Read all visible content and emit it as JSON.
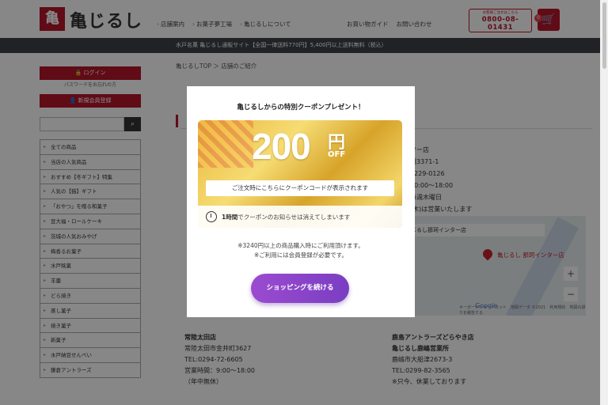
{
  "header": {
    "logo_mark": "亀",
    "logo_text": "亀じるし",
    "nav": [
      "店舗案内",
      "お菓子夢工場",
      "亀じるしについて"
    ],
    "nav2": [
      "お買い物ガイド",
      "お問い合わせ"
    ],
    "tel_small": "お客様ご注文はこちら",
    "tel_number": "0800-08-01431",
    "cart_count": "0"
  },
  "banner": {
    "text": "水戸名菓 亀じるし通販サイト【全国一律送料770円】5,400円以上送料無料（税込）"
  },
  "sidebar": {
    "login_label": "ログイン",
    "password_note": "パスワードをお忘れの方",
    "register_label": "新規会員登録",
    "search_placeholder": "",
    "categories": [
      "全ての商品",
      "当店の人気商品",
      "おすすめ【冬ギフト】特集",
      "人気の【猫】ギフト",
      "「おやつ」を贈る和菓子",
      "豆大福・ロールケーキ",
      "茨城の人気おみやげ",
      "梅香るお菓子",
      "水戸銘菓",
      "羊羹",
      "どら焼き",
      "蒸し菓子",
      "焼き菓子",
      "新菓子",
      "水戸納豆せんべい",
      "鎌倉アントラーズ"
    ]
  },
  "main": {
    "breadcrumb": "亀じるしTOP ＞ 店舗のご紹介",
    "store_right": [
      "ンター店",
      "飯田3371-1",
      "29-229-0126",
      "：10:00～18:00",
      "：毎週木曜日",
      "日(木)は営業いたします"
    ],
    "map": {
      "label": "亀じるし那珂インター店",
      "pin_name": "亀じるし 那珂インター店",
      "google": "Google",
      "footer": "キーボードショートカット　地図データ ©2021　利用規約　地図の誤りを報告する"
    },
    "store_a": {
      "name": "常陸太田店",
      "address": "常陸太田市金井町3627",
      "tel": "TEL:0294-72-6605",
      "hours": "営業時間：9:00～18:00",
      "holiday": "（年中無休）"
    },
    "store_b": {
      "name": "鹿島アントラーズどらやき店",
      "sub": "亀じるし鹿嶋営業所",
      "address": "鹿嶋市大船津2673-3",
      "tel": "TEL:0299-82-3565",
      "note": "※只今、休業しております"
    }
  },
  "modal": {
    "title": "亀じるしからの特別クーポンプレゼント！",
    "coupon_value": "200",
    "coupon_yen": "円",
    "coupon_off": "OFF",
    "coupon_bar": "ご注文時にこちらにクーポンコードが表示されます",
    "info_hour": "1時間",
    "info_rest": "でクーポンのお知らせは消えてしまいます",
    "note1": "※3240円以上の商品購入時にご利用頂けます。",
    "note2": "※ご利用には会員登録が必要です。",
    "continue_label": "ショッピングを続ける"
  }
}
